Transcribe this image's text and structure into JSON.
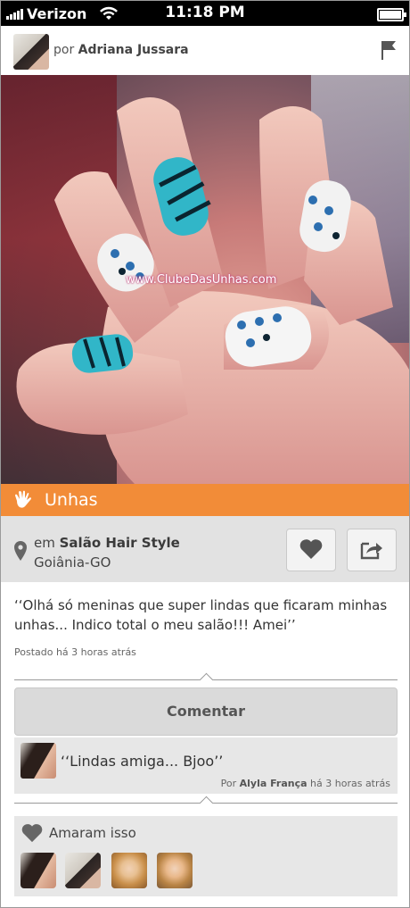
{
  "status_bar": {
    "carrier": "Verizon",
    "time": "11:18 PM"
  },
  "header": {
    "by_prefix": "por",
    "author": "Adriana Jussara",
    "icons": {
      "avatar": "author-avatar",
      "flag": "flag-icon"
    }
  },
  "photo": {
    "watermark": "www.ClubeDasUnhas.com"
  },
  "category": {
    "label": "Unhas",
    "color": "#f28c38",
    "icon": "hand-icon"
  },
  "location": {
    "prefix": "em",
    "salon": "Salão Hair Style",
    "city": "Goiânia-GO"
  },
  "post": {
    "text": "‘‘Olhá só meninas que super lindas que ficaram minhas unhas... Indico total o meu salão!!! Amei’’",
    "posted": "Postado há 3 horas atrás"
  },
  "comment_button": {
    "label": "Comentar"
  },
  "comment": {
    "text": "‘‘Lindas amiga... Bjoo’’",
    "by_prefix": "Por",
    "author": "Alyla França",
    "time": "há 3 horas atrás"
  },
  "likes": {
    "label": "Amaram isso",
    "avatars": [
      "liker-1",
      "liker-2",
      "liker-3",
      "liker-4"
    ]
  }
}
